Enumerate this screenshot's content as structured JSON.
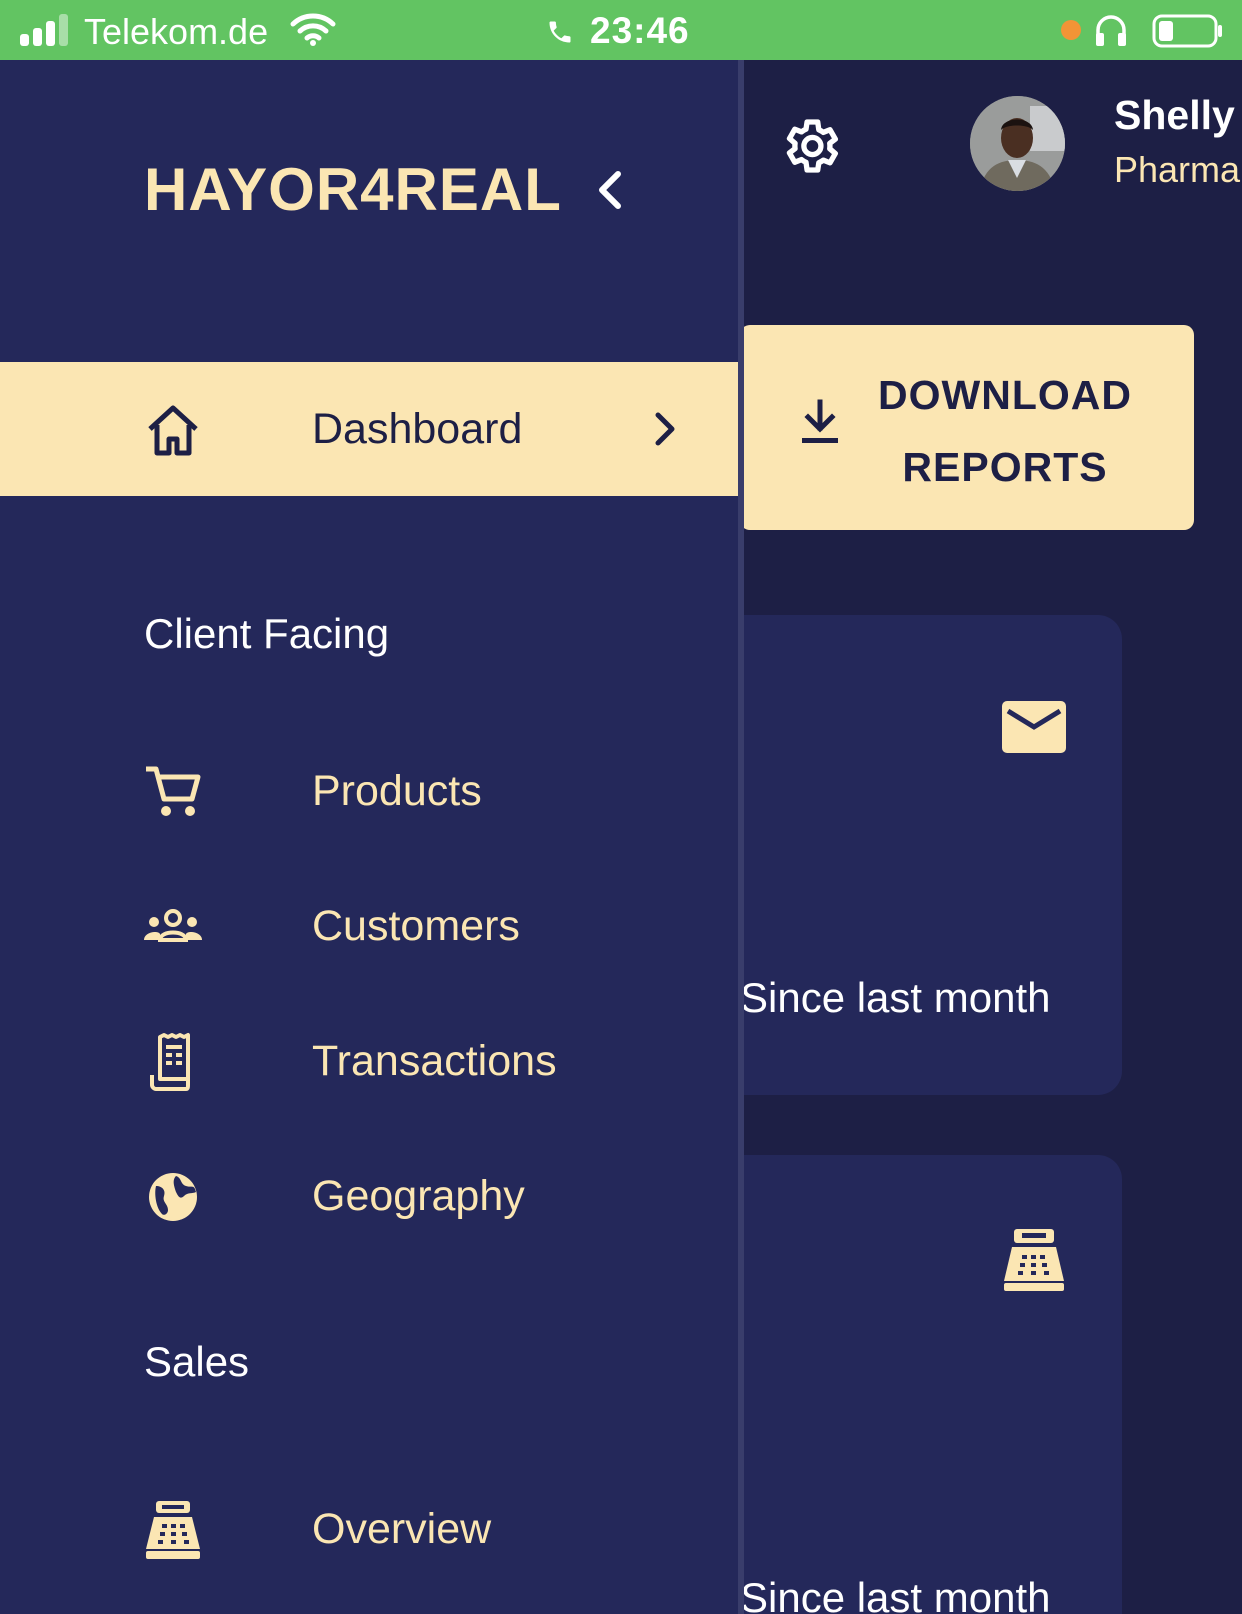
{
  "status_bar": {
    "carrier": "Telekom.de",
    "time": "23:46",
    "bg_color": "#62c462",
    "icons": [
      "signal-icon",
      "wifi-icon",
      "phone-icon",
      "orange-dot-indicator",
      "headphones-icon",
      "battery-icon"
    ]
  },
  "header": {
    "settings_icon": "gear-icon",
    "user": {
      "name": "Shelly",
      "role": "Pharma"
    }
  },
  "download_button": {
    "line1": "DOWNLOAD",
    "line2": "REPORTS",
    "icon": "download-icon"
  },
  "stat_cards": [
    {
      "icon": "mail-icon",
      "subtitle": "Since last month"
    },
    {
      "icon": "cash-register-icon",
      "subtitle": "Since last month"
    }
  ],
  "sidebar": {
    "brand": "HAYOR4REAL",
    "collapse_icon": "chevron-left-icon",
    "active_item": {
      "label": "Dashboard",
      "icon": "home-icon",
      "chevron": "chevron-right-icon"
    },
    "sections": [
      {
        "title": "Client Facing",
        "items": [
          {
            "label": "Products",
            "icon": "shopping-cart-icon"
          },
          {
            "label": "Customers",
            "icon": "groups-icon"
          },
          {
            "label": "Transactions",
            "icon": "receipt-icon"
          },
          {
            "label": "Geography",
            "icon": "globe-icon"
          }
        ]
      },
      {
        "title": "Sales",
        "items": [
          {
            "label": "Overview",
            "icon": "point-of-sale-icon"
          }
        ]
      }
    ]
  },
  "colors": {
    "background": "#1d1f45",
    "drawer": "#24285a",
    "accent": "#fbe6b3",
    "text_light": "#ffffff"
  }
}
